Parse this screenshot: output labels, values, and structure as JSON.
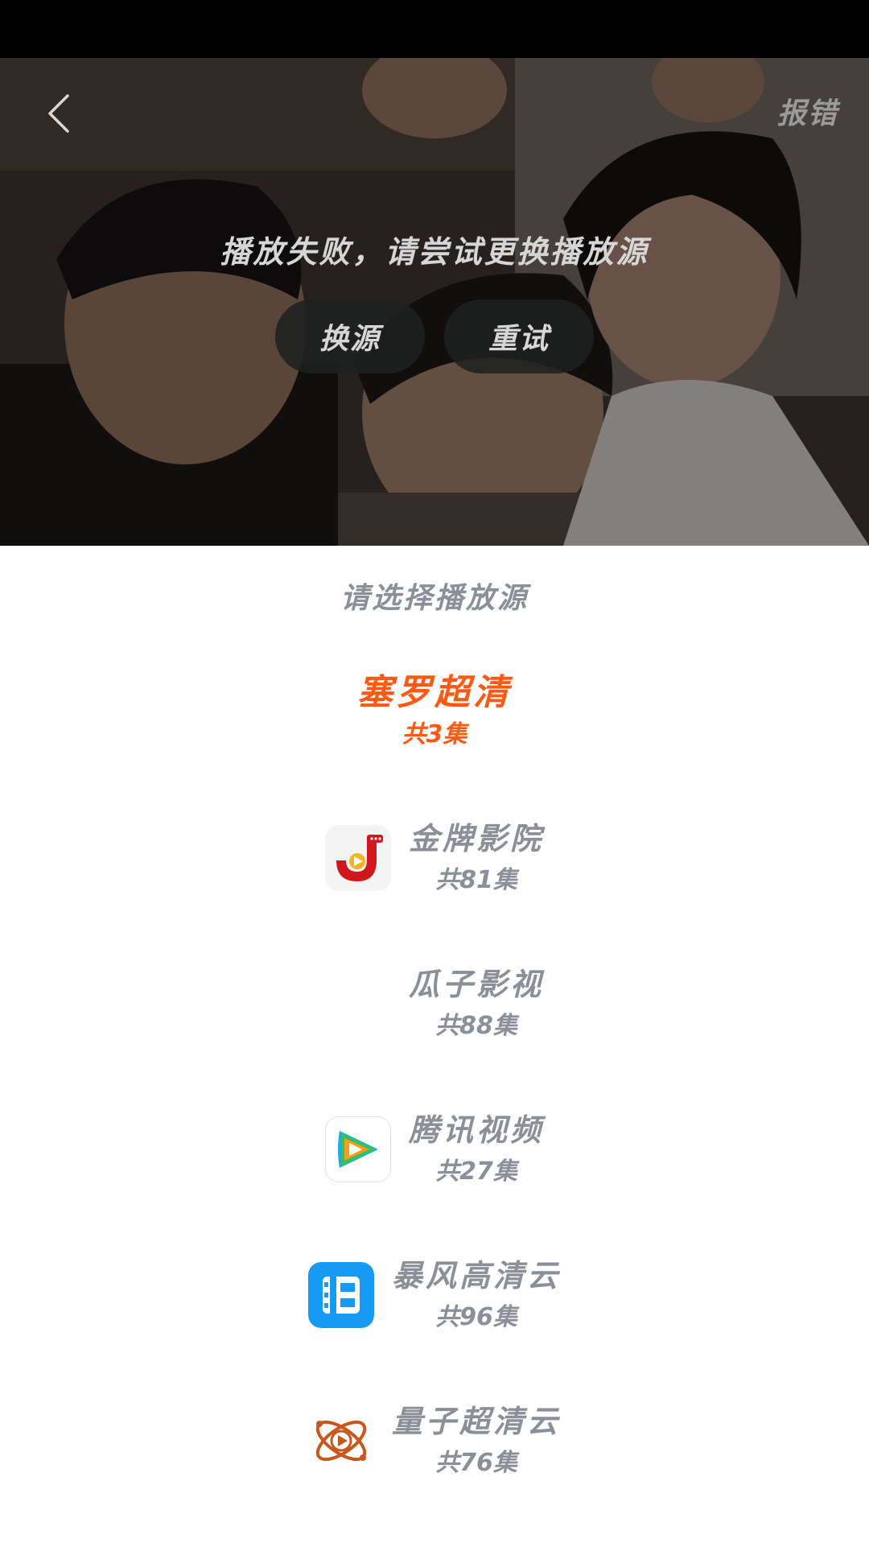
{
  "player": {
    "report_label": "报错",
    "error_message": "播放失败，请尝试更换播放源",
    "switch_label": "换源",
    "retry_label": "重试"
  },
  "sources": {
    "title": "请选择播放源",
    "items": [
      {
        "name": "塞罗超清",
        "count": "共3集",
        "active": true,
        "logo": "none"
      },
      {
        "name": "金牌影院",
        "count": "共81集",
        "active": false,
        "logo": "jinpai-logo-icon"
      },
      {
        "name": "瓜子影视",
        "count": "共88集",
        "active": false,
        "logo": "none"
      },
      {
        "name": "腾讯视频",
        "count": "共27集",
        "active": false,
        "logo": "tencent-video-logo-icon"
      },
      {
        "name": "暴风高清云",
        "count": "共96集",
        "active": false,
        "logo": "baofeng-logo-icon"
      },
      {
        "name": "量子超清云",
        "count": "共76集",
        "active": false,
        "logo": "liangzi-logo-icon"
      }
    ]
  },
  "colors": {
    "accent": "#ff5a14",
    "muted_text": "#8a8f99",
    "overlay_text": "#d6d6d6"
  }
}
